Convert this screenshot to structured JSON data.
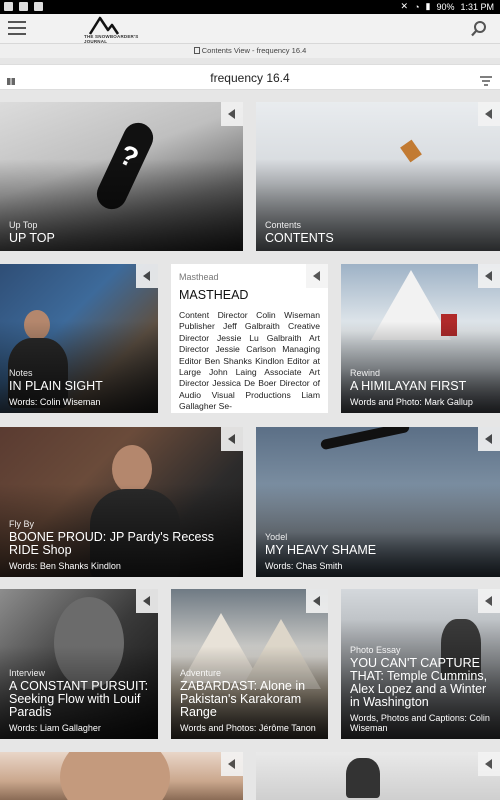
{
  "status_bar": {
    "battery": "90%",
    "time": "1:31 PM"
  },
  "header": {
    "logo_text": "THE SNOWBOARDER'S JOURNAL"
  },
  "breadcrumb": {
    "text": "Contents View - frequency 16.4"
  },
  "issue": {
    "title": "frequency 16.4"
  },
  "tiles": {
    "uptop": {
      "category": "Up Top",
      "title": "UP TOP"
    },
    "contents": {
      "category": "Contents",
      "title": "CONTENTS"
    },
    "plainsight": {
      "category": "Notes",
      "title": "IN PLAIN SIGHT",
      "byline": "Words: Colin Wiseman"
    },
    "masthead": {
      "category": "Masthead",
      "title": "MASTHEAD",
      "body": "Content Director Colin Wiseman Publisher Jeff Galbraith Creative Director Jessie Lu Galbraith Art Director Jessie Carlson Managing Editor Ben Shanks Kindlon Editor at Large John Laing Associate Art Director Jessica De Boer Director of Audio Visual Productions Liam Gallagher Se-"
    },
    "himalayan": {
      "category": "Rewind",
      "title": "A HIMILAYAN FIRST",
      "byline": "Words and Photo: Mark Gallup"
    },
    "boone": {
      "category": "Fly By",
      "title": "BOONE PROUD: JP Pardy's Recess RIDE Shop",
      "byline": "Words: Ben Shanks Kindlon"
    },
    "heavy": {
      "category": "Yodel",
      "title": "MY HEAVY SHAME",
      "byline": "Words: Chas Smith"
    },
    "pursuit": {
      "category": "Interview",
      "title": "A CONSTANT PURSUIT: Seeking Flow with Louif Paradis",
      "byline": "Words: Liam Gallagher"
    },
    "zabar": {
      "category": "Adventure",
      "title": "ZABARDAST: Alone in Pakistan's Karakoram Range",
      "byline": "Words and Photos: Jérôme Tanon"
    },
    "capture": {
      "category": "Photo Essay",
      "title": "YOU CAN'T CAPTURE THAT: Temple Cummins, Alex Lopez and a Winter in Washington",
      "byline": "Words, Photos and Captions: Colin Wiseman"
    }
  }
}
